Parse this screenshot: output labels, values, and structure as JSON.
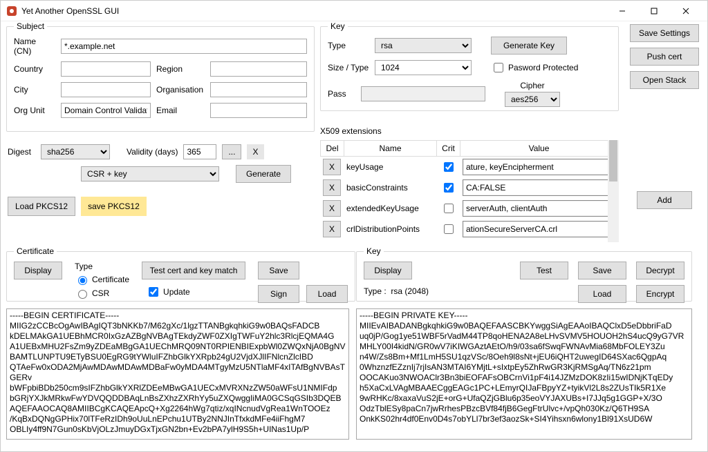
{
  "window": {
    "title": "Yet Another OpenSSL GUI"
  },
  "right_buttons": {
    "save_settings": "Save Settings",
    "push_cert": "Push cert",
    "open_stack": "Open Stack"
  },
  "subject": {
    "legend": "Subject",
    "name_label": "Name (CN)",
    "name_value": "*.example.net",
    "country_label": "Country",
    "country_value": "",
    "region_label": "Region",
    "region_value": "",
    "city_label": "City",
    "city_value": "",
    "org_label": "Organisation",
    "org_value": "",
    "orgunit_label": "Org Unit",
    "orgunit_value": "Domain Control Validated",
    "email_label": "Email",
    "email_value": ""
  },
  "key": {
    "legend": "Key",
    "type_label": "Type",
    "type_value": "rsa",
    "size_label": "Size / Type",
    "size_value": "1024",
    "genkey": "Generate Key",
    "pw_protected": "Pasword Protected",
    "pass_label": "Pass",
    "pass_value": "",
    "cipher_label": "Cipher",
    "cipher_value": "aes256"
  },
  "ext": {
    "label": "X509 extensions",
    "add": "Add",
    "cols": {
      "del": "Del",
      "name": "Name",
      "crit": "Crit",
      "value": "Value"
    },
    "rows": [
      {
        "del": "X",
        "name": "keyUsage",
        "crit": true,
        "value": "ature, keyEncipherment"
      },
      {
        "del": "X",
        "name": "basicConstraints",
        "crit": true,
        "value": "CA:FALSE"
      },
      {
        "del": "X",
        "name": "extendedKeyUsage",
        "crit": false,
        "value": "serverAuth, clientAuth"
      },
      {
        "del": "X",
        "name": "crlDistributionPoints",
        "crit": false,
        "value": "ationSecureServerCA.crl"
      }
    ]
  },
  "digest": {
    "label": "Digest",
    "value": "sha256",
    "validity_label": "Validity (days)",
    "validity_value": "365",
    "dots": "...",
    "close_x": "X",
    "mode": "CSR + key",
    "generate": "Generate",
    "load_pkcs12": "Load PKCS12",
    "save_pkcs12": "save PKCS12"
  },
  "cert_panel": {
    "legend": "Certificate",
    "display": "Display",
    "type_label": "Type",
    "opt_cert": "Certificate",
    "opt_csr": "CSR",
    "test_match": "Test cert and key match",
    "save": "Save",
    "update": "Update",
    "sign": "Sign",
    "load": "Load"
  },
  "key_panel": {
    "legend": "Key",
    "display": "Display",
    "type_label": "Type :",
    "type_value": "rsa (2048)",
    "test": "Test",
    "save": "Save",
    "decrypt": "Decrypt",
    "load": "Load",
    "encrypt": "Encrypt"
  },
  "cert_text": "-----BEGIN CERTIFICATE-----\nMIIG2zCCBcOgAwIBAgIQT3bNKKb7/M62gXc/1lgzTTANBgkqhkiG9w0BAQsFADCB\nkDELMAkGA1UEBhMCR0IxGzAZBgNVBAgTEkdyZWF0ZXIgTWFuY2hlc3RlcjEQMA4G\nA1UEBxMHU2FsZm9yZDEaMBgGA1UEChMRQ09NT0RPIENBIExpbWl0ZWQxNjA0BgNV\nBAMTLUNPTU9ETyBSU0EgRG9tYWluIFZhbGlkYXRpb24gU2VjdXJlIFNlcnZlcIBD\nQTAeFw0xODA2MjAwMDAwMDAwMDBaFw0yMDA4MTgyMzU5NTlaMF4xITAfBgNVBAsTGERv\nbWFpbiBDb250cm9sIFZhbGlkYXRlZDEeMBwGA1UECxMVRXNzZW50aWFsU1NMIFdp\nbGRjYXJkMRkwFwYDVQQDDBAqLnBsZXhzZXRhYy5uZXQwggIiMA0GCSqGSIb3DQEB\nAQEFAAOCAQ8AMIIBCgKCAQEApcQ+Xg2264hWg7qtiz/xqINcnudVgRea1WnTOOEz\n/KqBxDQNgGPHix70lTFeRzIDh9oUuLnEPchu1UTBy2NNJInTfxkdMFe4iiFhgM7\nOBLIy4ff9N7Gun0sKbVjOLzJmuyDGxTjxGN2bn+Ev2bPA7ylH9S5h+UINas1Up/P",
  "key_text": "-----BEGIN PRIVATE KEY-----\nMIIEvAIBADANBgkqhkiG9w0BAQEFAASCBKYwggSiAgEAAoIBAQClxD5eDbbriFaD\nuq0jP/Gog1ye51WBF5rVadM44TP8qoHENA2A8eLHvSVMV5HOUOH2hS4ucQ9yG7VR\nMHLY00I4kidN/GR0wV7iKIWGAztAEtO/h9/03sa6fSwqFWNAvMia68MbFOLEY3Zu\nn4W/Zs8Bm+Mf1LmH5SU1qzVSc/8Oeh9l8sNt+jEU6iQHT2uwegID64SXac6QgpAq\n0WhznzfEZznIj7rjIsAN3MTAI6YMjtL+sIxtpEy5ZhRwGR3KjRMSgAq/TN6z21pm\nOOCAKuo3NWOAClr3Bn3biEOFAFsOBCrnVi1pF4i14JZMzDOK8zIi15wIDNjKTqEDy\nh5XaCxLVAgMBAAECggEAGc1PC+LEmyrQIJaFBpyYZ+tyikVl2L8s2ZUsTIk5R1Xe\n9wRHKc/8xaxaVuS2jE+orG+UfaQZjGBlu6p35eoVYJAXUBs+I7JJq5g1GGP+X/3O\nOdzTblESy8paCn7jwRrhesPBzcBVf84fjB6GegFtrUlvc+/vpQh030Kz/Q6TH9SA\nOnkKS02hr4df0Env0D4s7obYLl7br3ef3aozSk+SI4Yihsxn6wlony1Bl91XsUD6W"
}
